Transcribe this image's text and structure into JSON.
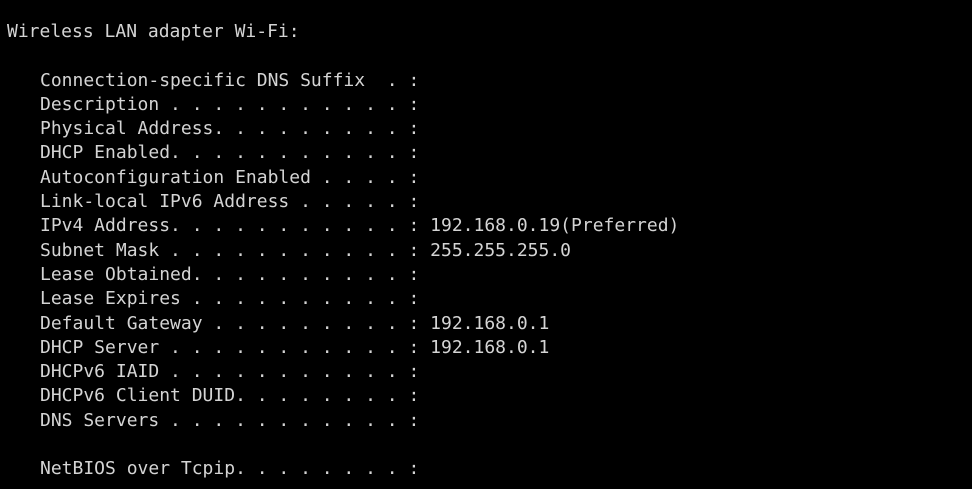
{
  "adapter": {
    "heading": "Wireless LAN adapter Wi-Fi:"
  },
  "rows": [
    {
      "label": "Connection-specific DNS Suffix  . : ",
      "value": ""
    },
    {
      "label": "Description . . . . . . . . . . . : ",
      "value": ""
    },
    {
      "label": "Physical Address. . . . . . . . . : ",
      "value": ""
    },
    {
      "label": "DHCP Enabled. . . . . . . . . . . : ",
      "value": ""
    },
    {
      "label": "Autoconfiguration Enabled . . . . : ",
      "value": ""
    },
    {
      "label": "Link-local IPv6 Address . . . . . : ",
      "value": ""
    },
    {
      "label": "IPv4 Address. . . . . . . . . . . : ",
      "value": "192.168.0.19(Preferred)"
    },
    {
      "label": "Subnet Mask . . . . . . . . . . . : ",
      "value": "255.255.255.0"
    },
    {
      "label": "Lease Obtained. . . . . . . . . . : ",
      "value": ""
    },
    {
      "label": "Lease Expires . . . . . . . . . . : ",
      "value": ""
    },
    {
      "label": "Default Gateway . . . . . . . . . : ",
      "value": "192.168.0.1"
    },
    {
      "label": "DHCP Server . . . . . . . . . . . : ",
      "value": "192.168.0.1"
    },
    {
      "label": "DHCPv6 IAID . . . . . . . . . . . : ",
      "value": ""
    },
    {
      "label": "DHCPv6 Client DUID. . . . . . . . : ",
      "value": ""
    },
    {
      "label": "DNS Servers . . . . . . . . . . . : ",
      "value": ""
    }
  ],
  "netbios": {
    "label": "NetBIOS over Tcpip. . . . . . . . : ",
    "value": ""
  }
}
